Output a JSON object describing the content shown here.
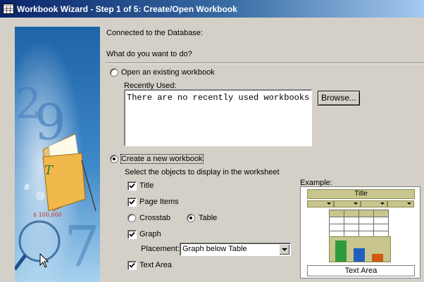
{
  "window": {
    "title": "Workbook Wizard - Step 1 of 5: Create/Open Workbook",
    "icon": "workbook-icon"
  },
  "status": {
    "connected_label": "Connected to the Database:"
  },
  "question": "What do you want to do?",
  "open_option": {
    "label": "Open an existing workbook",
    "selected": false,
    "recently_used_label": "Recently Used:",
    "recently_used_text": "There are no recently used workbooks.",
    "browse_label": "Browse..."
  },
  "create_option": {
    "label": "Create a new workbook",
    "selected": true,
    "instructions": "Select the objects to display in the worksheet",
    "objects": {
      "title": {
        "label": "Title",
        "checked": true
      },
      "page_items": {
        "label": "Page Items",
        "checked": true
      },
      "crosstab": {
        "label": "Crosstab",
        "selected": false
      },
      "table": {
        "label": "Table",
        "selected": true
      },
      "graph": {
        "label": "Graph",
        "checked": true
      },
      "placement_label": "Placement:",
      "placement_value": "Graph below Table",
      "text_area": {
        "label": "Text Area",
        "checked": true
      }
    }
  },
  "example": {
    "label": "Example:",
    "title_text": "Title",
    "text_area_text": "Text Area",
    "bar_colors": [
      "#2e9a3a",
      "#1f5fbf",
      "#d05a10"
    ],
    "header_color": "#c8c68c"
  }
}
